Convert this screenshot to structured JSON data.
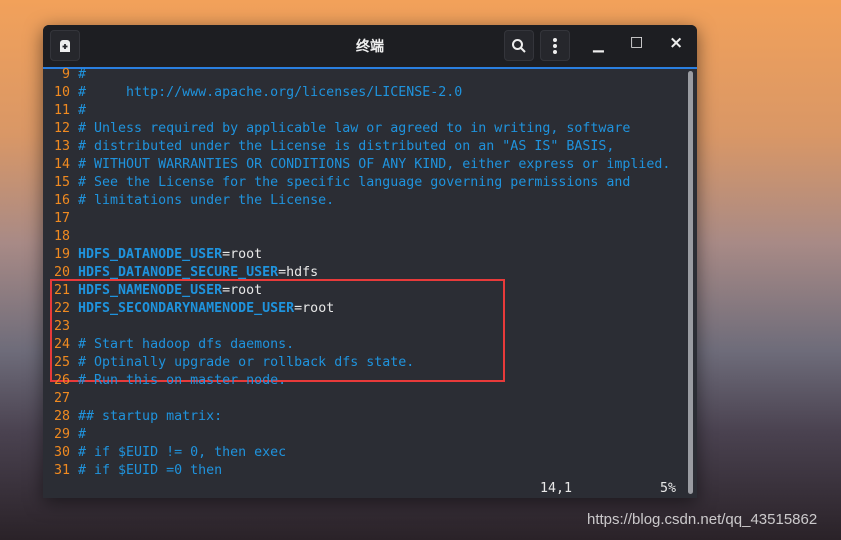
{
  "window": {
    "title": "终端",
    "new_tab_icon": "new-tab-icon",
    "search_icon": "search-icon",
    "menu_icon": "kebab-menu-icon",
    "minimize": "▁",
    "maximize": "□",
    "close": "×"
  },
  "editor": {
    "lines": [
      {
        "n": "9",
        "parts": [
          {
            "t": "#",
            "c": "cm"
          }
        ]
      },
      {
        "n": "10",
        "parts": [
          {
            "t": "#     http://www.apache.org/licenses/LICENSE-2.0",
            "c": "cm"
          }
        ]
      },
      {
        "n": "11",
        "parts": [
          {
            "t": "#",
            "c": "cm"
          }
        ]
      },
      {
        "n": "12",
        "parts": [
          {
            "t": "# Unless required by applicable law or agreed to in writing, software",
            "c": "cm"
          }
        ]
      },
      {
        "n": "13",
        "parts": [
          {
            "t": "# distributed under the License is distributed on an \"AS IS\" BASIS,",
            "c": "cm"
          }
        ]
      },
      {
        "n": "14",
        "parts": [
          {
            "t": "# WITHOUT WARRANTIES OR CONDITIONS OF ANY KIND, either express or implied.",
            "c": "cm"
          }
        ]
      },
      {
        "n": "15",
        "parts": [
          {
            "t": "# See the License for the specific language governing permissions and",
            "c": "cm"
          }
        ]
      },
      {
        "n": "16",
        "parts": [
          {
            "t": "# limitations under the License.",
            "c": "cm"
          }
        ]
      },
      {
        "n": "17",
        "parts": []
      },
      {
        "n": "18",
        "parts": []
      },
      {
        "n": "19",
        "parts": [
          {
            "t": "HDFS_DATANODE_USER",
            "c": "var"
          },
          {
            "t": "=root",
            "c": "val"
          }
        ]
      },
      {
        "n": "20",
        "parts": [
          {
            "t": "HDFS_DATANODE_SECURE_USER",
            "c": "var"
          },
          {
            "t": "=hdfs",
            "c": "val"
          }
        ]
      },
      {
        "n": "21",
        "parts": [
          {
            "t": "HDFS_NAMENODE_USER",
            "c": "var"
          },
          {
            "t": "=root",
            "c": "val"
          }
        ]
      },
      {
        "n": "22",
        "parts": [
          {
            "t": "HDFS_SECONDARYNAMENODE_USER",
            "c": "var"
          },
          {
            "t": "=root",
            "c": "val"
          }
        ]
      },
      {
        "n": "23",
        "parts": []
      },
      {
        "n": "24",
        "parts": [
          {
            "t": "# Start hadoop dfs daemons.",
            "c": "cm"
          }
        ]
      },
      {
        "n": "25",
        "parts": [
          {
            "t": "# Optinally upgrade or rollback dfs state.",
            "c": "cm"
          }
        ]
      },
      {
        "n": "26",
        "parts": [
          {
            "t": "# Run this on master node.",
            "c": "cm"
          }
        ]
      },
      {
        "n": "27",
        "parts": []
      },
      {
        "n": "28",
        "parts": [
          {
            "t": "## startup matrix:",
            "c": "cm"
          }
        ]
      },
      {
        "n": "29",
        "parts": [
          {
            "t": "#",
            "c": "cm"
          }
        ]
      },
      {
        "n": "30",
        "parts": [
          {
            "t": "# if $EUID != 0, then exec",
            "c": "cm"
          }
        ]
      },
      {
        "n": "31",
        "parts": [
          {
            "t": "# if $EUID =0 then",
            "c": "cm"
          }
        ]
      }
    ],
    "cursor_position": "14,1",
    "scroll_percent": "5%"
  },
  "watermark": "https://blog.csdn.net/qq_43515862",
  "colors": {
    "line_number": "#f08a20",
    "comment": "#1f93dd",
    "highlight_box": "#e83a3a",
    "accent": "#2a7fe0"
  }
}
